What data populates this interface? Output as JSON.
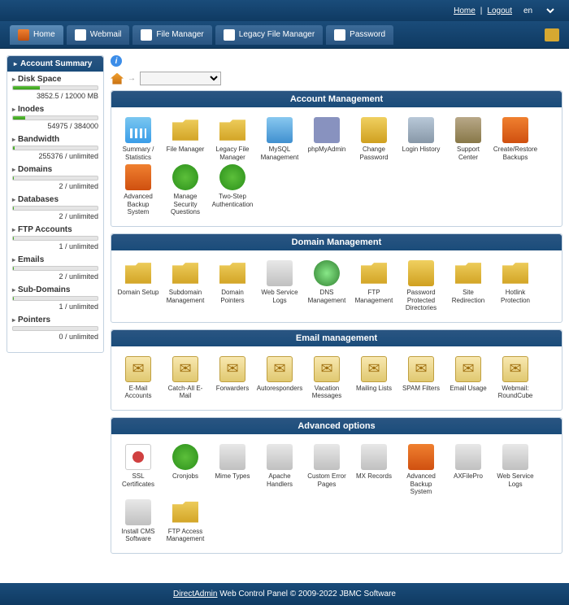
{
  "top": {
    "home": "Home",
    "logout": "Logout",
    "lang": "en"
  },
  "nav": {
    "t0": "Home",
    "t1": "Webmail",
    "t2": "File Manager",
    "t3": "Legacy File Manager",
    "t4": "Password"
  },
  "side": {
    "title": "Account Summary",
    "s0": {
      "label": "Disk Space",
      "val": "3852.5 / 12000 MB",
      "pct": 32
    },
    "s1": {
      "label": "Inodes",
      "val": "54975 / 384000",
      "pct": 14
    },
    "s2": {
      "label": "Bandwidth",
      "val": "255376 / unlimited",
      "pct": 2
    },
    "s3": {
      "label": "Domains",
      "val": "2 / unlimited",
      "pct": 1
    },
    "s4": {
      "label": "Databases",
      "val": "2 / unlimited",
      "pct": 1
    },
    "s5": {
      "label": "FTP Accounts",
      "val": "1 / unlimited",
      "pct": 1
    },
    "s6": {
      "label": "Emails",
      "val": "2 / unlimited",
      "pct": 1
    },
    "s7": {
      "label": "Sub-Domains",
      "val": "1 / unlimited",
      "pct": 1
    },
    "s8": {
      "label": "Pointers",
      "val": "0 / unlimited",
      "pct": 0
    }
  },
  "sec": {
    "account": {
      "title": "Account Management",
      "i": [
        "Summary / Statistics",
        "File Manager",
        "Legacy File Manager",
        "MySQL Management",
        "phpMyAdmin",
        "Change Password",
        "Login History",
        "Support Center",
        "Create/Restore Backups",
        "Advanced Backup System",
        "Manage Security Questions",
        "Two-Step Authentication"
      ]
    },
    "domain": {
      "title": "Domain Management",
      "i": [
        "Domain Setup",
        "Subdomain Management",
        "Domain Pointers",
        "Web Service Logs",
        "DNS Management",
        "FTP Management",
        "Password Protected Directories",
        "Site Redirection",
        "Hotlink Protection"
      ]
    },
    "email": {
      "title": "Email management",
      "i": [
        "E-Mail Accounts",
        "Catch-All E-Mail",
        "Forwarders",
        "Autoresponders",
        "Vacation Messages",
        "Mailing Lists",
        "SPAM Filters",
        "Email Usage",
        "Webmail: RoundCube"
      ]
    },
    "adv": {
      "title": "Advanced options",
      "i": [
        "SSL Certificates",
        "Cronjobs",
        "Mime Types",
        "Apache Handlers",
        "Custom Error Pages",
        "MX Records",
        "Advanced Backup System",
        "AXFilePro",
        "Web Service Logs",
        "Install CMS Software",
        "FTP Access Management"
      ]
    }
  },
  "footer": {
    "link": "DirectAdmin",
    "text": " Web Control Panel © 2009-2022 JBMC Software"
  }
}
